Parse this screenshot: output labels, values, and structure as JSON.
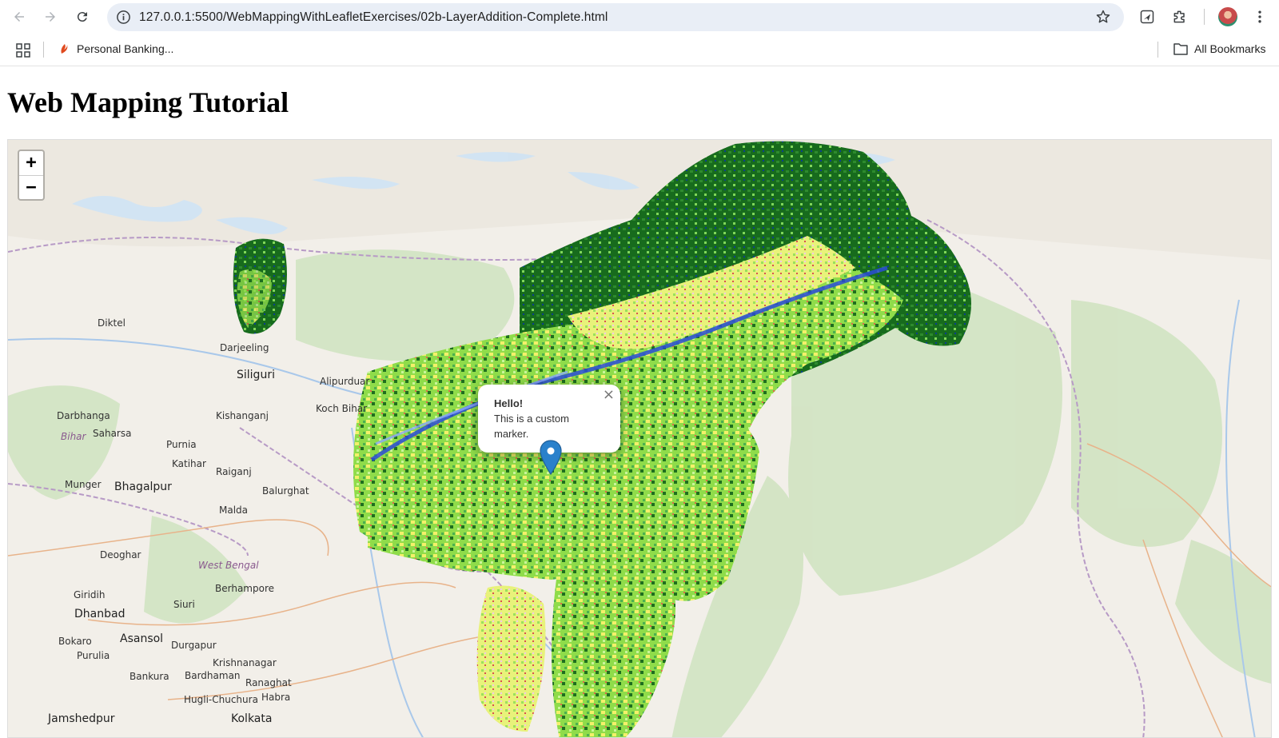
{
  "browser": {
    "url": "127.0.0.1:5500/WebMappingWithLeafletExercises/02b-LayerAddition-Complete.html",
    "bookmark_item": "Personal Banking...",
    "all_bookmarks": "All Bookmarks",
    "icons": [
      "back-icon",
      "forward-icon",
      "reload-icon",
      "site-info-icon",
      "star-icon",
      "send-icon",
      "extensions-icon",
      "profile-avatar",
      "more-menu-icon",
      "apps-icon",
      "folder-icon"
    ]
  },
  "page": {
    "title": "Web Mapping Tutorial"
  },
  "map": {
    "zoom_in": "+",
    "zoom_out": "−",
    "popup": {
      "close": "×",
      "heading": "Hello!",
      "text": "This is a custom marker."
    },
    "place_labels": {
      "siliguri": "Siliguri",
      "darjeeling": "Darjeeling",
      "alipurduar": "Alipurduar",
      "kishanganj": "Kishanganj",
      "koch_bihar": "Koch Bihar",
      "purnia": "Purnia",
      "katihar": "Katihar",
      "raiganj": "Raiganj",
      "balurghat": "Balurghat",
      "bhagalpur": "Bhagalpur",
      "malda": "Malda",
      "deoghar": "Deoghar",
      "west_bengal": "West Bengal",
      "berhampore": "Berhampore",
      "dhanbad": "Dhanbad",
      "asansol": "Asansol",
      "durgapur": "Durgapur",
      "bardhaman": "Bardhaman",
      "kolkata": "Kolkata",
      "jamshedpur": "Jamshedpur",
      "darbhanga": "Darbhanga",
      "saharsa": "Saharsa",
      "bihar": "Bihar",
      "diktel": "Diktel",
      "munger": "Munger",
      "giridih": "Giridih",
      "bokaro": "Bokaro",
      "purulia": "Purulia",
      "bankura": "Bankura",
      "krishnanagar": "Krishnanagar",
      "ranaghat": "Ranaghat",
      "hugli_chuchura": "Hugli-Chuchura",
      "habra": "Habra",
      "siuri": "Siuri"
    }
  }
}
